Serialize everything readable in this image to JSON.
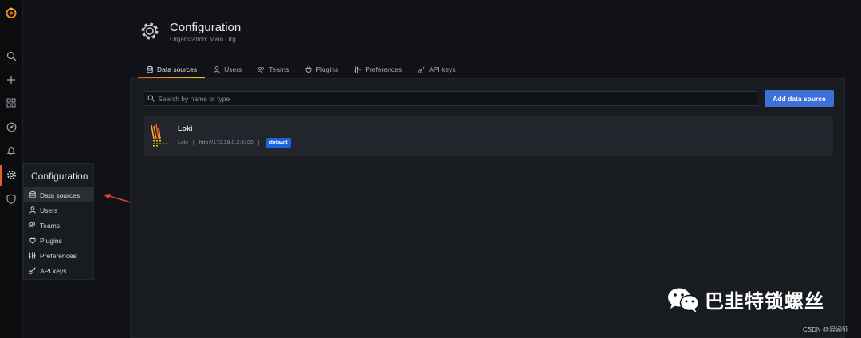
{
  "sidebar": {
    "icons": [
      "grafana-logo-icon",
      "search-icon",
      "plus-icon",
      "dashboards-icon",
      "explore-compass-icon",
      "bell-icon",
      "gear-icon",
      "shield-icon"
    ]
  },
  "flyout": {
    "title": "Configuration",
    "items": [
      {
        "label": "Data sources",
        "icon": "database-icon"
      },
      {
        "label": "Users",
        "icon": "user-icon"
      },
      {
        "label": "Teams",
        "icon": "users-icon"
      },
      {
        "label": "Plugins",
        "icon": "plug-icon"
      },
      {
        "label": "Preferences",
        "icon": "sliders-icon"
      },
      {
        "label": "API keys",
        "icon": "key-icon"
      }
    ]
  },
  "header": {
    "title": "Configuration",
    "subtitle": "Organization: Main Org."
  },
  "tabs": [
    {
      "label": "Data sources",
      "active": true
    },
    {
      "label": "Users"
    },
    {
      "label": "Teams"
    },
    {
      "label": "Plugins"
    },
    {
      "label": "Preferences"
    },
    {
      "label": "API keys"
    }
  ],
  "search": {
    "placeholder": "Search by name or type",
    "value": ""
  },
  "add_button": "Add data source",
  "datasources": [
    {
      "name": "Loki",
      "type": "Loki",
      "separator": "|",
      "url": "http://172.18.0.2:3100",
      "badge": "default"
    }
  ],
  "watermark": {
    "text": "巴韭特锁螺丝",
    "csdn": "CSDN @异闻师"
  },
  "colors": {
    "accent": "#f05a28",
    "primary_button": "#3d71d9",
    "badge": "#1f62e0",
    "background": "#111217",
    "panel": "#181b1f"
  }
}
